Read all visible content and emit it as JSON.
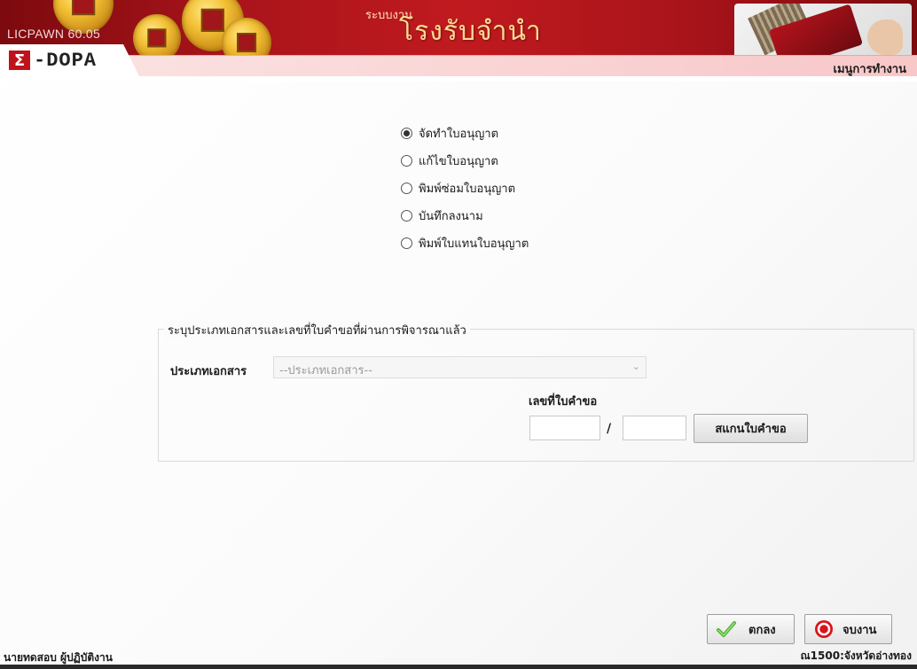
{
  "header": {
    "app_version": "LICPAWN 60.05",
    "system_label": "ระบบงาน",
    "system_title": "โรงรับจำนำ",
    "logo_sigma": "Σ",
    "logo_text": "-DOPA",
    "menu_label": "เมนูการทำงาน"
  },
  "options": [
    {
      "label": "จัดทำใบอนุญาต",
      "checked": true
    },
    {
      "label": "แก้ไขใบอนุญาต",
      "checked": false
    },
    {
      "label": "พิมพ์ซ่อมใบอนุญาต",
      "checked": false
    },
    {
      "label": "บันทึกลงนาม",
      "checked": false
    },
    {
      "label": "พิมพ์ใบแทนใบอนุญาต",
      "checked": false
    }
  ],
  "document_group": {
    "legend": "ระบุประเภทเอกสารและเลขที่ใบคำขอที่ผ่านการพิจารณาแล้ว",
    "doc_type_label": "ประเภทเอกสาร",
    "doc_type_placeholder": "--ประเภทเอกสาร--",
    "request_no_label": "เลขที่ใบคำขอ",
    "request_no_part1": "",
    "request_no_part2": "",
    "separator": "/",
    "scan_button_label": "สแกนใบคำขอ"
  },
  "actions": {
    "ok_label": "ตกลง",
    "exit_label": "จบงาน"
  },
  "footer": {
    "user": "นายทดสอบ ผู้ปฏิบัติงาน",
    "branch": "ณ1500:จังหวัดอ่างทอง"
  },
  "colors": {
    "banner_red": "#c01a1f",
    "menu_strip_pink": "#f8c7c8",
    "ok_check_green": "#4caf2e",
    "exit_icon_red": "#d8141c"
  }
}
